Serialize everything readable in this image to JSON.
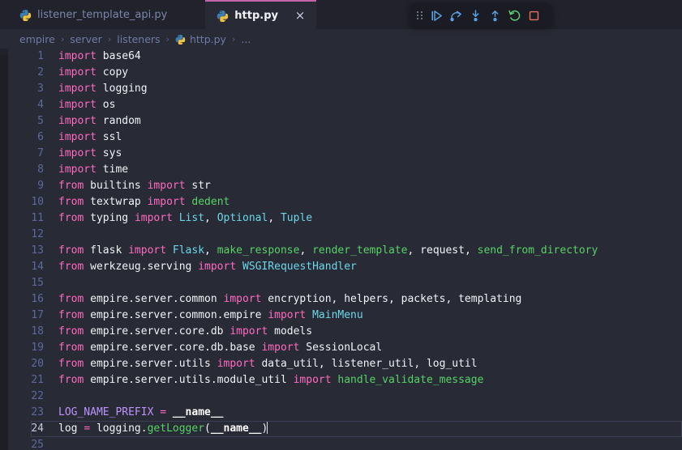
{
  "window": {
    "app": "vscode",
    "background": "#282a36",
    "chrome_background": "#21222c"
  },
  "tabs": [
    {
      "label": "listener_template_api.py",
      "icon": "python-file-icon",
      "active": false,
      "close_label": "×"
    },
    {
      "label": "http.py",
      "icon": "python-file-icon",
      "active": true,
      "close_label": "×"
    }
  ],
  "debug_toolbar": {
    "visible": true,
    "buttons": [
      {
        "name": "drag-handle",
        "title": "Drag"
      },
      {
        "name": "continue-button",
        "title": "Continue",
        "color": "#5aa3e8"
      },
      {
        "name": "step-over-button",
        "title": "Step Over",
        "color": "#5aa3e8"
      },
      {
        "name": "step-into-button",
        "title": "Step Into",
        "color": "#5aa3e8"
      },
      {
        "name": "step-out-button",
        "title": "Step Out",
        "color": "#5aa3e8"
      },
      {
        "name": "restart-button",
        "title": "Restart",
        "color": "#5fd37a"
      },
      {
        "name": "stop-button",
        "title": "Stop",
        "color": "#e8705f"
      }
    ]
  },
  "breadcrumb": {
    "items": [
      {
        "label": "empire",
        "icon": null
      },
      {
        "label": "server",
        "icon": null
      },
      {
        "label": "listeners",
        "icon": null
      },
      {
        "label": "http.py",
        "icon": "python-file-icon"
      },
      {
        "label": "...",
        "icon": null
      }
    ],
    "separator": "›"
  },
  "editor": {
    "language": "python",
    "cursor_line": 24,
    "current_line": 24,
    "first_line": 1,
    "last_visible_line": 25,
    "lines": [
      {
        "n": 1,
        "tokens": [
          {
            "t": "import",
            "c": "kw"
          },
          {
            "t": " base64",
            "c": "txt"
          }
        ]
      },
      {
        "n": 2,
        "tokens": [
          {
            "t": "import",
            "c": "kw"
          },
          {
            "t": " copy",
            "c": "txt"
          }
        ]
      },
      {
        "n": 3,
        "tokens": [
          {
            "t": "import",
            "c": "kw"
          },
          {
            "t": " logging",
            "c": "txt"
          }
        ]
      },
      {
        "n": 4,
        "tokens": [
          {
            "t": "import",
            "c": "kw"
          },
          {
            "t": " os",
            "c": "txt"
          }
        ]
      },
      {
        "n": 5,
        "tokens": [
          {
            "t": "import",
            "c": "kw"
          },
          {
            "t": " random",
            "c": "txt"
          }
        ]
      },
      {
        "n": 6,
        "tokens": [
          {
            "t": "import",
            "c": "kw"
          },
          {
            "t": " ssl",
            "c": "txt"
          }
        ]
      },
      {
        "n": 7,
        "tokens": [
          {
            "t": "import",
            "c": "kw"
          },
          {
            "t": " sys",
            "c": "txt"
          }
        ]
      },
      {
        "n": 8,
        "tokens": [
          {
            "t": "import",
            "c": "kw"
          },
          {
            "t": " time",
            "c": "txt"
          }
        ]
      },
      {
        "n": 9,
        "tokens": [
          {
            "t": "from",
            "c": "kw"
          },
          {
            "t": " builtins ",
            "c": "txt"
          },
          {
            "t": "import",
            "c": "kw"
          },
          {
            "t": " str",
            "c": "txt"
          }
        ]
      },
      {
        "n": 10,
        "tokens": [
          {
            "t": "from",
            "c": "kw"
          },
          {
            "t": " textwrap ",
            "c": "txt"
          },
          {
            "t": "import",
            "c": "kw"
          },
          {
            "t": " ",
            "c": "txt"
          },
          {
            "t": "dedent",
            "c": "fn"
          }
        ]
      },
      {
        "n": 11,
        "tokens": [
          {
            "t": "from",
            "c": "kw"
          },
          {
            "t": " typing ",
            "c": "txt"
          },
          {
            "t": "import",
            "c": "kw"
          },
          {
            "t": " ",
            "c": "txt"
          },
          {
            "t": "List",
            "c": "cls"
          },
          {
            "t": ", ",
            "c": "punc"
          },
          {
            "t": "Optional",
            "c": "cls"
          },
          {
            "t": ", ",
            "c": "punc"
          },
          {
            "t": "Tuple",
            "c": "cls"
          }
        ]
      },
      {
        "n": 12,
        "tokens": []
      },
      {
        "n": 13,
        "tokens": [
          {
            "t": "from",
            "c": "kw"
          },
          {
            "t": " flask ",
            "c": "txt"
          },
          {
            "t": "import",
            "c": "kw"
          },
          {
            "t": " ",
            "c": "txt"
          },
          {
            "t": "Flask",
            "c": "cls"
          },
          {
            "t": ", ",
            "c": "punc"
          },
          {
            "t": "make_response",
            "c": "fn"
          },
          {
            "t": ", ",
            "c": "punc"
          },
          {
            "t": "render_template",
            "c": "fn"
          },
          {
            "t": ", ",
            "c": "punc"
          },
          {
            "t": "request",
            "c": "txt"
          },
          {
            "t": ", ",
            "c": "punc"
          },
          {
            "t": "send_from_directory",
            "c": "fn"
          }
        ]
      },
      {
        "n": 14,
        "tokens": [
          {
            "t": "from",
            "c": "kw"
          },
          {
            "t": " werkzeug.serving ",
            "c": "txt"
          },
          {
            "t": "import",
            "c": "kw"
          },
          {
            "t": " ",
            "c": "txt"
          },
          {
            "t": "WSGIRequestHandler",
            "c": "cls"
          }
        ]
      },
      {
        "n": 15,
        "tokens": []
      },
      {
        "n": 16,
        "tokens": [
          {
            "t": "from",
            "c": "kw"
          },
          {
            "t": " empire.server.common ",
            "c": "txt"
          },
          {
            "t": "import",
            "c": "kw"
          },
          {
            "t": " encryption, helpers, packets, templating",
            "c": "txt"
          }
        ]
      },
      {
        "n": 17,
        "tokens": [
          {
            "t": "from",
            "c": "kw"
          },
          {
            "t": " empire.server.common.empire ",
            "c": "txt"
          },
          {
            "t": "import",
            "c": "kw"
          },
          {
            "t": " ",
            "c": "txt"
          },
          {
            "t": "MainMenu",
            "c": "cls"
          }
        ]
      },
      {
        "n": 18,
        "tokens": [
          {
            "t": "from",
            "c": "kw"
          },
          {
            "t": " empire.server.core.db ",
            "c": "txt"
          },
          {
            "t": "import",
            "c": "kw"
          },
          {
            "t": " models",
            "c": "txt"
          }
        ]
      },
      {
        "n": 19,
        "tokens": [
          {
            "t": "from",
            "c": "kw"
          },
          {
            "t": " empire.server.core.db.base ",
            "c": "txt"
          },
          {
            "t": "import",
            "c": "kw"
          },
          {
            "t": " SessionLocal",
            "c": "txt"
          }
        ]
      },
      {
        "n": 20,
        "tokens": [
          {
            "t": "from",
            "c": "kw"
          },
          {
            "t": " empire.server.utils ",
            "c": "txt"
          },
          {
            "t": "import",
            "c": "kw"
          },
          {
            "t": " data_util, listener_util, log_util",
            "c": "txt"
          }
        ]
      },
      {
        "n": 21,
        "tokens": [
          {
            "t": "from",
            "c": "kw"
          },
          {
            "t": " empire.server.utils.module_util ",
            "c": "txt"
          },
          {
            "t": "import",
            "c": "kw"
          },
          {
            "t": " ",
            "c": "txt"
          },
          {
            "t": "handle_validate_message",
            "c": "fn"
          }
        ]
      },
      {
        "n": 22,
        "tokens": []
      },
      {
        "n": 23,
        "tokens": [
          {
            "t": "LOG_NAME_PREFIX",
            "c": "cnst"
          },
          {
            "t": " ",
            "c": "txt"
          },
          {
            "t": "=",
            "c": "op"
          },
          {
            "t": " ",
            "c": "txt"
          },
          {
            "t": "__name__",
            "c": "dund"
          }
        ]
      },
      {
        "n": 24,
        "tokens": [
          {
            "t": "log",
            "c": "txt"
          },
          {
            "t": " ",
            "c": "txt"
          },
          {
            "t": "=",
            "c": "op"
          },
          {
            "t": " logging",
            "c": "txt"
          },
          {
            "t": ".",
            "c": "punc"
          },
          {
            "t": "getLogger",
            "c": "fn"
          },
          {
            "t": "(",
            "c": "punc"
          },
          {
            "t": "__name__",
            "c": "dund"
          },
          {
            "t": ")",
            "c": "punc"
          }
        ]
      },
      {
        "n": 25,
        "tokens": []
      }
    ]
  }
}
